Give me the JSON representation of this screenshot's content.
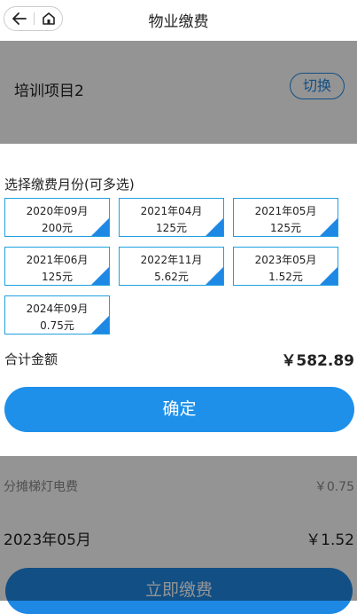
{
  "nav": {
    "title": "物业缴费",
    "back_icon": "back-arrow-icon",
    "home_icon": "home-icon"
  },
  "background": {
    "project_name": "培训项目2",
    "switch_label": "切换",
    "fee_item": {
      "name": "分摊梯灯电费",
      "amount": "￥0.75"
    },
    "month_row": {
      "month": "2023年05月",
      "amount": "￥1.52"
    },
    "pay_label": "立即缴费"
  },
  "sheet": {
    "title": "选择缴费月份(可多选)",
    "months": [
      {
        "month": "2020年09月",
        "amount": "200元",
        "selected": true
      },
      {
        "month": "2021年04月",
        "amount": "125元",
        "selected": true
      },
      {
        "month": "2021年05月",
        "amount": "125元",
        "selected": true
      },
      {
        "month": "2021年06月",
        "amount": "125元",
        "selected": true
      },
      {
        "month": "2022年11月",
        "amount": "5.62元",
        "selected": true
      },
      {
        "month": "2023年05月",
        "amount": "1.52元",
        "selected": true
      },
      {
        "month": "2024年09月",
        "amount": "0.75元",
        "selected": true
      }
    ],
    "total_label": "合计金额",
    "total_value": "￥582.89",
    "confirm_label": "确定"
  },
  "colors": {
    "accent": "#1e88e5",
    "tile_border": "#1ea0e0",
    "mask": "rgba(0,0,0,0.42)"
  }
}
